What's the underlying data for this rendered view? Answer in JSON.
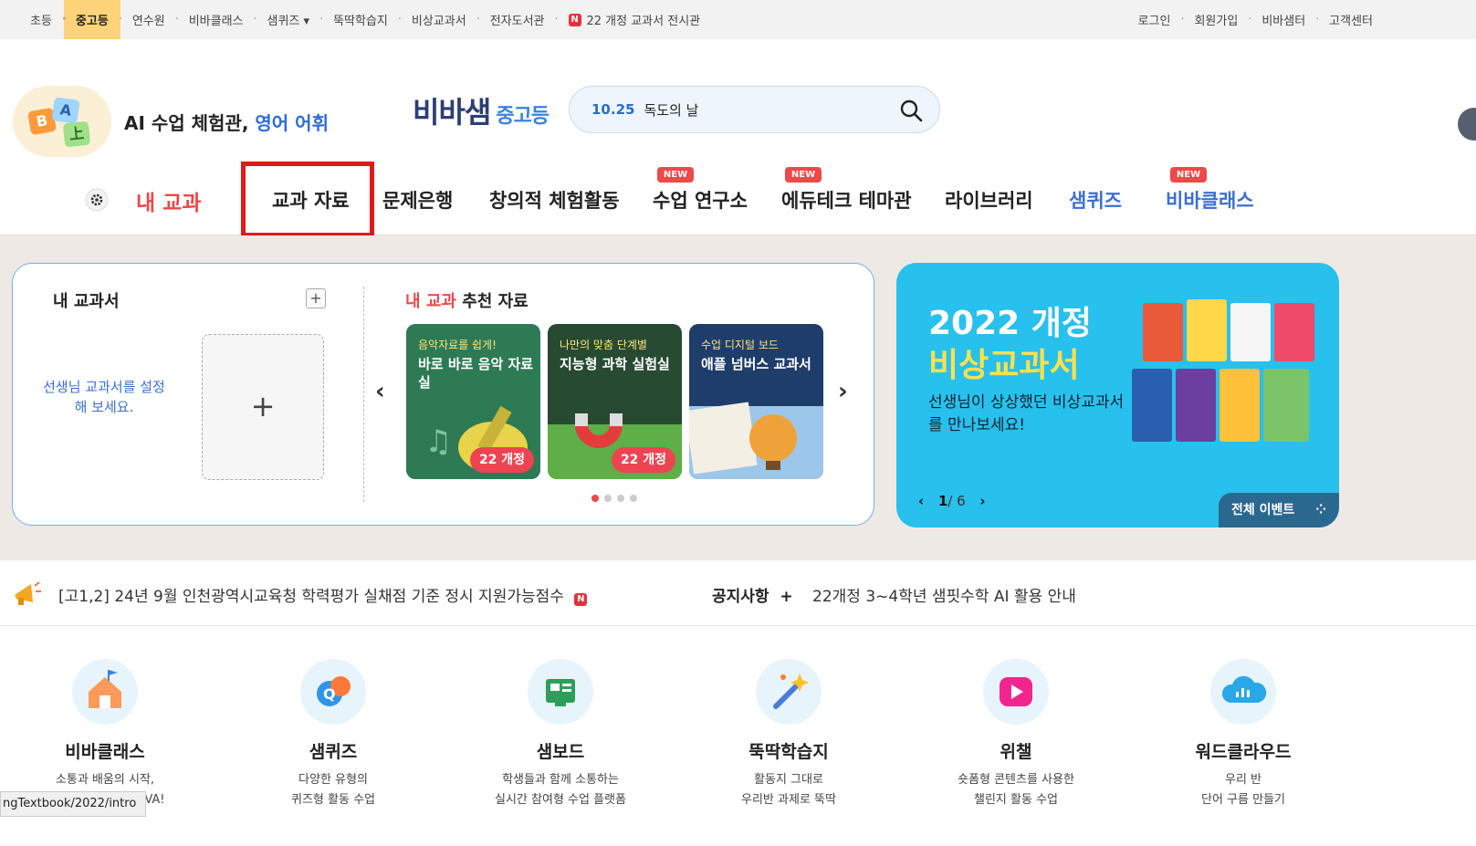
{
  "topbar": {
    "left": [
      "초등",
      "중고등",
      "연수원",
      "비바클래스",
      "샘퀴즈 ▾",
      "뚝딱학습지",
      "비상교과서",
      "전자도서관",
      "22 개정 교과서 전시관"
    ],
    "right": [
      "로그인",
      "회원가입",
      "비바샘터",
      "고객센터"
    ],
    "n_badge": "N"
  },
  "promo": {
    "prefix": "AI 수업 체험관, ",
    "accent": "영어 어휘"
  },
  "logo": {
    "name": "비바샘",
    "level": "중고등"
  },
  "search": {
    "date": "10.25",
    "text": "독도의 날"
  },
  "gnb": {
    "my_subject": "내 교과",
    "items": [
      "교과 자료",
      "문제은행",
      "창의적 체험활동",
      "수업 연구소",
      "에듀테크 테마관",
      "라이브러리",
      "샘퀴즈",
      "비바클래스"
    ],
    "new_label": "NEW"
  },
  "mybooks": {
    "title": "내 교과서",
    "add": "+",
    "guide": "선생님 교과서를 설정해 보세요.",
    "add_big": "+"
  },
  "recommend": {
    "title_accent": "내 교과",
    "title_rest": " 추천 자료",
    "prev": "‹",
    "next": "›",
    "cards": [
      {
        "small": "음악자료를 쉽게!",
        "big": "바로 바로 음악 자료실",
        "pill": "22 개정"
      },
      {
        "small": "나만의 맞춤 단계별",
        "big": "지능형 과학 실험실",
        "pill": "22 개정"
      },
      {
        "small": "수업 디지털 보드",
        "big": "애플 넘버스 교과서",
        "pill": ""
      }
    ]
  },
  "event": {
    "line1": "2022 개정",
    "line2": "비상교과서",
    "sub": "선생님이 상상했던 비상교과서를 만나보세요!",
    "page": "1",
    "total": "/ 6",
    "all": "전체 이벤트"
  },
  "notice": {
    "headline": "[고1,2] 24년 9월 인천광역시교육청 학력평가 실채점 기준 정시 지원가능점수",
    "label": "공지사항",
    "plus": "+",
    "item": "22개정 3~4학년 샘핏수학 AI 활용 안내"
  },
  "services": [
    {
      "name": "비바클래스",
      "desc1": "소통과 배움의 시작,",
      "desc2": "우리반 소통 공간 VIVA!"
    },
    {
      "name": "샘퀴즈",
      "desc1": "다양한 유형의",
      "desc2": "퀴즈형 활동 수업"
    },
    {
      "name": "샘보드",
      "desc1": "학생들과 함께 소통하는",
      "desc2": "실시간 참여형 수업 플랫폼"
    },
    {
      "name": "뚝딱학습지",
      "desc1": "활동지 그대로",
      "desc2": "우리반 과제로 뚝딱"
    },
    {
      "name": "위챌",
      "desc1": "숏폼형 콘텐츠를 사용한",
      "desc2": "챌린지 활동 수업"
    },
    {
      "name": "워드클라우드",
      "desc1": "우리 반",
      "desc2": "단어 구름 만들기"
    }
  ],
  "status_url": "ngTextbook/2022/intro",
  "colors": {
    "accent_red": "#e01a1a",
    "brand_blue": "#3b82e0",
    "event_bg": "#28c0ec"
  }
}
